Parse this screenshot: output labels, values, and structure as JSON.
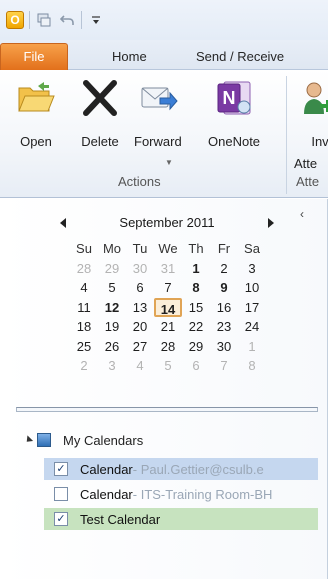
{
  "qat": {
    "app_icon_label": "O",
    "icons": [
      "outlook-icon",
      "send-receive-icon",
      "undo-icon",
      "customize-icon"
    ]
  },
  "tabs": {
    "file": "File",
    "home": "Home",
    "send_receive": "Send / Receive"
  },
  "ribbon": {
    "buttons": [
      {
        "label": "Open",
        "icon": "open-folder-icon"
      },
      {
        "label": "Delete",
        "icon": "delete-x-icon"
      },
      {
        "label": "Forward",
        "icon": "forward-icon"
      },
      {
        "label": "OneNote",
        "icon": "onenote-icon"
      },
      {
        "label": "Inv",
        "icon": "invite-icon"
      }
    ],
    "invite_line2": "Atte",
    "groups": {
      "actions": "Actions",
      "attendees": "Atte"
    }
  },
  "calendar": {
    "month_label": "September 2011",
    "weekdays": [
      "Su",
      "Mo",
      "Tu",
      "We",
      "Th",
      "Fr",
      "Sa"
    ],
    "weeks": [
      [
        {
          "d": "28",
          "o": true
        },
        {
          "d": "29",
          "o": true
        },
        {
          "d": "30",
          "o": true
        },
        {
          "d": "31",
          "o": true
        },
        {
          "d": "1",
          "b": true
        },
        {
          "d": "2"
        },
        {
          "d": "3"
        }
      ],
      [
        {
          "d": "4"
        },
        {
          "d": "5"
        },
        {
          "d": "6"
        },
        {
          "d": "7"
        },
        {
          "d": "8",
          "b": true
        },
        {
          "d": "9",
          "b": true
        },
        {
          "d": "10"
        }
      ],
      [
        {
          "d": "11"
        },
        {
          "d": "12",
          "b": true
        },
        {
          "d": "13"
        },
        {
          "d": "14",
          "t": true
        },
        {
          "d": "15"
        },
        {
          "d": "16"
        },
        {
          "d": "17"
        }
      ],
      [
        {
          "d": "18"
        },
        {
          "d": "19"
        },
        {
          "d": "20"
        },
        {
          "d": "21"
        },
        {
          "d": "22"
        },
        {
          "d": "23"
        },
        {
          "d": "24"
        }
      ],
      [
        {
          "d": "25"
        },
        {
          "d": "26"
        },
        {
          "d": "27"
        },
        {
          "d": "28"
        },
        {
          "d": "29"
        },
        {
          "d": "30"
        },
        {
          "d": "1",
          "o": true
        }
      ],
      [
        {
          "d": "2",
          "o": true
        },
        {
          "d": "3",
          "o": true
        },
        {
          "d": "4",
          "o": true
        },
        {
          "d": "5",
          "o": true
        },
        {
          "d": "6",
          "o": true
        },
        {
          "d": "7",
          "o": true
        },
        {
          "d": "8",
          "o": true
        }
      ]
    ]
  },
  "my_calendars": {
    "label": "My Calendars",
    "items": [
      {
        "name": "Calendar",
        "owner": " - Paul.Gettier@csulb.e",
        "checked": true,
        "style": "selected"
      },
      {
        "name": "Calendar",
        "owner": " - ITS-Training Room-BH",
        "checked": false,
        "style": "plain"
      },
      {
        "name": "Test Calendar",
        "owner": "",
        "checked": true,
        "style": "green"
      }
    ]
  },
  "colors": {
    "file_tab": "#e2701b",
    "today_border": "#e0a455",
    "selected_row": "#c5d7ef",
    "green_row": "#c7e3bf"
  }
}
